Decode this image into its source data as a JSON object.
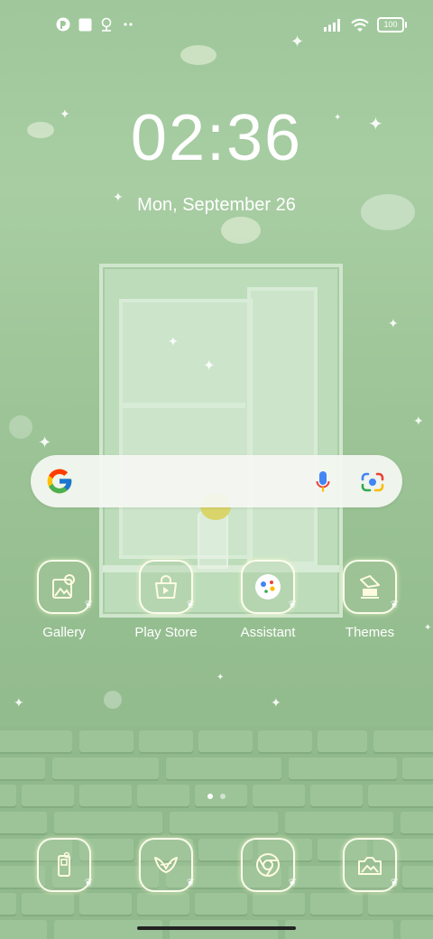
{
  "status_bar": {
    "left_icons": [
      "app-notification-icon",
      "square-notification-icon",
      "location-notification-icon",
      "more-dots-icon"
    ],
    "right_icons": [
      "signal-icon",
      "wifi-icon",
      "battery-icon"
    ],
    "battery_level": "100"
  },
  "clock": {
    "time": "02:36",
    "date": "Mon, September 26"
  },
  "search_bar": {
    "icons": [
      "google-g-icon",
      "mic-icon",
      "lens-camera-icon"
    ]
  },
  "apps_row": [
    {
      "label": "Gallery",
      "icon": "gallery-icon"
    },
    {
      "label": "Play Store",
      "icon": "play-store-icon"
    },
    {
      "label": "Assistant",
      "icon": "assistant-icon"
    },
    {
      "label": "Themes",
      "icon": "themes-icon"
    }
  ],
  "page_indicator": {
    "pages": 2,
    "current": 1
  },
  "dock": [
    {
      "icon": "phone-icon"
    },
    {
      "icon": "messages-icon"
    },
    {
      "icon": "chrome-icon"
    },
    {
      "icon": "camera-icon"
    }
  ],
  "colors": {
    "background": "#9fc79b",
    "icon_glow": "#fffbe0",
    "search_bg": "#f5f8f3"
  }
}
